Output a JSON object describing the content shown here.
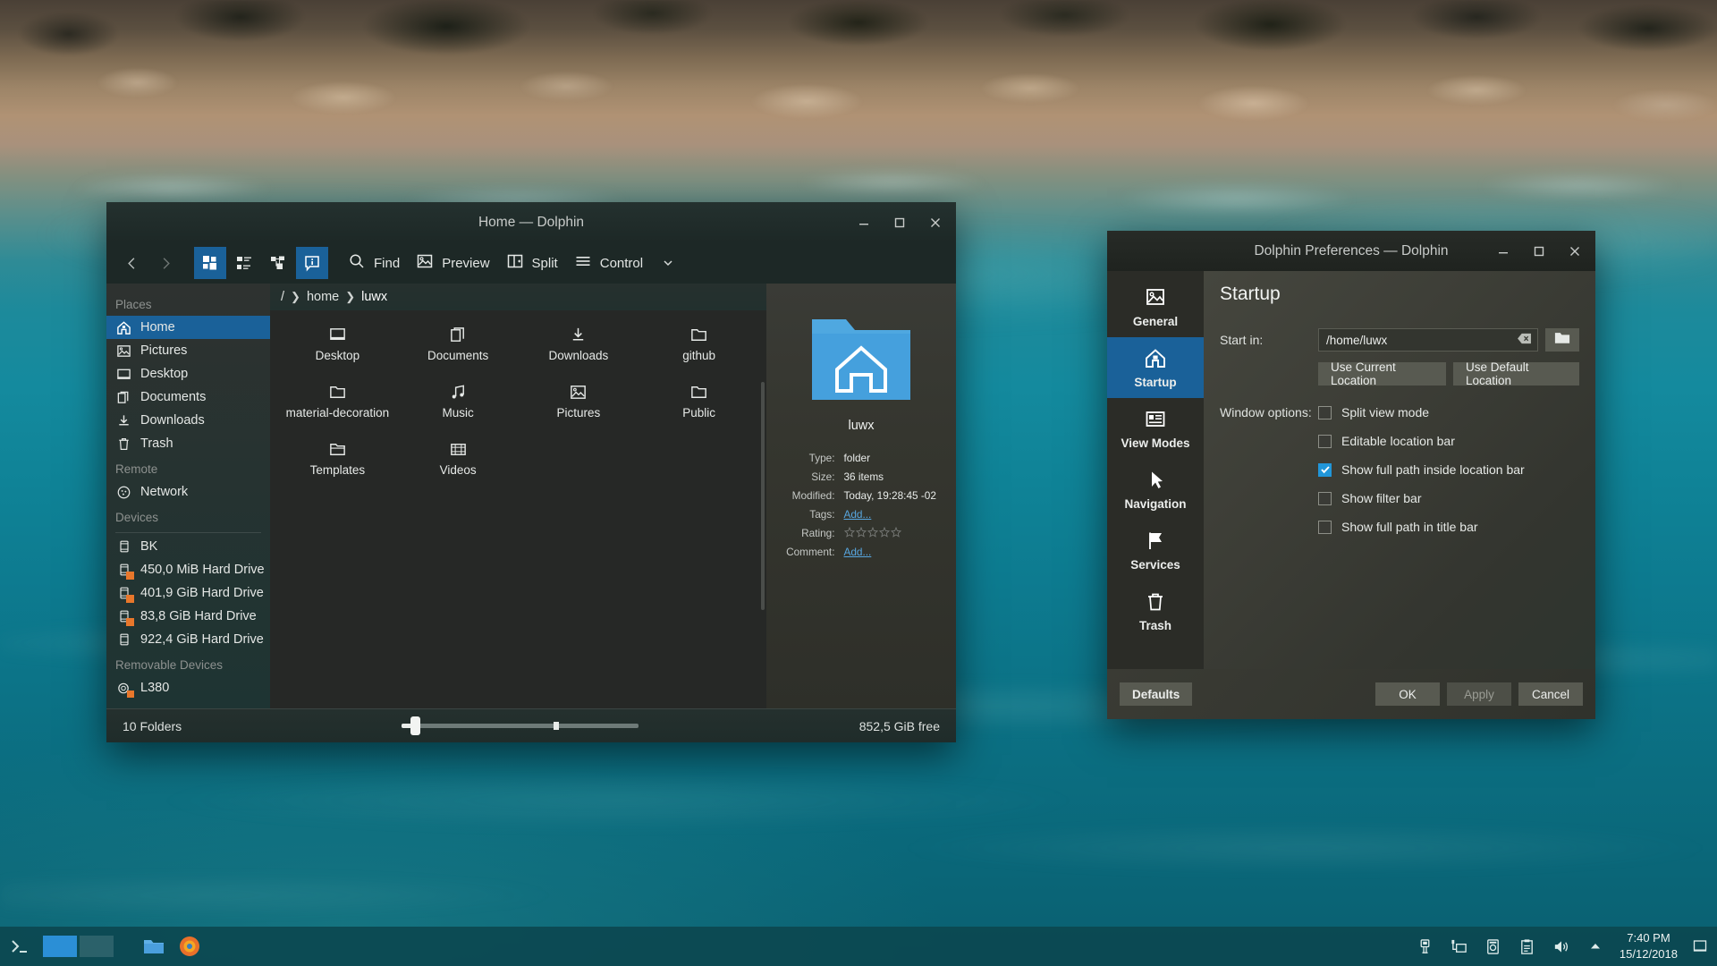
{
  "desktop": {
    "wallpaper_name": "coastal-aerial-wallpaper"
  },
  "dolphin": {
    "title": "Home — Dolphin",
    "window_buttons": {
      "minimize": "minimize-icon",
      "maximize": "maximize-icon",
      "close": "close-icon"
    },
    "toolbar": {
      "back": "back-icon",
      "forward": "forward-icon",
      "view_icons": "view-icons-icon",
      "view_compact": "view-compact-icon",
      "view_details": "view-details-icon",
      "info_panel": "information-panel-icon",
      "find_label": "Find",
      "preview_label": "Preview",
      "split_label": "Split",
      "control_label": "Control"
    },
    "sidebar": {
      "sections": [
        {
          "title": "Places",
          "items": [
            {
              "label": "Home",
              "icon": "home-icon",
              "selected": true
            },
            {
              "label": "Pictures",
              "icon": "pictures-icon",
              "selected": false
            },
            {
              "label": "Desktop",
              "icon": "desktop-icon",
              "selected": false
            },
            {
              "label": "Documents",
              "icon": "documents-icon",
              "selected": false
            },
            {
              "label": "Downloads",
              "icon": "downloads-icon",
              "selected": false
            },
            {
              "label": "Trash",
              "icon": "trash-icon",
              "selected": false
            }
          ]
        },
        {
          "title": "Remote",
          "items": [
            {
              "label": "Network",
              "icon": "network-icon",
              "selected": false
            }
          ]
        },
        {
          "title": "Devices",
          "items": [
            {
              "label": "BK",
              "icon": "drive-icon",
              "selected": false,
              "mounted": false
            },
            {
              "label": "450,0 MiB Hard Drive",
              "icon": "drive-icon",
              "selected": false,
              "mounted": true
            },
            {
              "label": "401,9 GiB Hard Drive",
              "icon": "drive-icon",
              "selected": false,
              "mounted": true
            },
            {
              "label": "83,8 GiB Hard Drive",
              "icon": "drive-icon",
              "selected": false,
              "mounted": true
            },
            {
              "label": "922,4 GiB Hard Drive",
              "icon": "drive-icon",
              "selected": false,
              "mounted": false
            }
          ]
        },
        {
          "title": "Removable Devices",
          "items": [
            {
              "label": "L380",
              "icon": "camera-icon",
              "selected": false,
              "mounted": true
            }
          ]
        }
      ]
    },
    "breadcrumb": {
      "root": "/",
      "parts": [
        "home",
        "luwx"
      ]
    },
    "files": [
      {
        "label": "Desktop",
        "icon": "folder-desktop-icon"
      },
      {
        "label": "Documents",
        "icon": "folder-documents-icon"
      },
      {
        "label": "Downloads",
        "icon": "folder-downloads-icon"
      },
      {
        "label": "github",
        "icon": "folder-icon"
      },
      {
        "label": "material-decoration",
        "icon": "folder-icon"
      },
      {
        "label": "Music",
        "icon": "folder-music-icon"
      },
      {
        "label": "Pictures",
        "icon": "folder-pictures-icon"
      },
      {
        "label": "Public",
        "icon": "folder-icon"
      },
      {
        "label": "Templates",
        "icon": "folder-templates-icon"
      },
      {
        "label": "Videos",
        "icon": "folder-videos-icon"
      }
    ],
    "info_panel": {
      "preview_icon": "folder-home-large-icon",
      "name": "luwx",
      "metadata": [
        {
          "key": "Type:",
          "value": "folder",
          "kind": "text"
        },
        {
          "key": "Size:",
          "value": "36 items",
          "kind": "text"
        },
        {
          "key": "Modified:",
          "value": "Today, 19:28:45 -02",
          "kind": "text"
        },
        {
          "key": "Tags:",
          "value": "Add...",
          "kind": "link"
        },
        {
          "key": "Rating:",
          "value": "",
          "kind": "stars"
        },
        {
          "key": "Comment:",
          "value": "Add...",
          "kind": "link"
        }
      ],
      "rating_stars": 5,
      "rating_filled": 0
    },
    "status": {
      "items_label": "10 Folders",
      "free_label": "852,5 GiB free",
      "zoom_value": 4
    }
  },
  "preferences": {
    "title": "Dolphin Preferences — Dolphin",
    "nav": [
      {
        "label": "General",
        "icon": "general-image-icon",
        "selected": false
      },
      {
        "label": "Startup",
        "icon": "startup-home-icon",
        "selected": true
      },
      {
        "label": "View Modes",
        "icon": "view-modes-icon",
        "selected": false
      },
      {
        "label": "Navigation",
        "icon": "navigation-cursor-icon",
        "selected": false
      },
      {
        "label": "Services",
        "icon": "services-flag-icon",
        "selected": false
      },
      {
        "label": "Trash",
        "icon": "trash-icon",
        "selected": false
      }
    ],
    "page_title": "Startup",
    "start_in": {
      "label": "Start in:",
      "value": "/home/luwx",
      "clear_icon": "clear-text-icon",
      "browse_icon": "folder-browse-icon"
    },
    "location_buttons": [
      "Use Current Location",
      "Use Default Location"
    ],
    "window_options_label": "Window options:",
    "window_options": [
      {
        "label": "Split view mode",
        "checked": false
      },
      {
        "label": "Editable location bar",
        "checked": false
      },
      {
        "label": "Show full path inside location bar",
        "checked": true
      },
      {
        "label": "Show filter bar",
        "checked": false
      },
      {
        "label": "Show full path in title bar",
        "checked": false
      }
    ],
    "footer": {
      "defaults": "Defaults",
      "ok": "OK",
      "apply": "Apply",
      "apply_disabled": true,
      "cancel": "Cancel"
    }
  },
  "taskbar": {
    "launcher_icon": "application-launcher-icon",
    "pager": [
      {
        "active": true
      },
      {
        "active": false
      }
    ],
    "tasks": [
      {
        "icon": "dolphin-file-manager-icon"
      },
      {
        "icon": "firefox-icon"
      }
    ],
    "tray": [
      {
        "icon": "usb-device-icon"
      },
      {
        "icon": "network-wired-icon"
      },
      {
        "icon": "device-notifier-icon"
      },
      {
        "icon": "clipboard-icon"
      },
      {
        "icon": "volume-icon"
      },
      {
        "icon": "show-hidden-icons-arrow-icon"
      }
    ],
    "clock": {
      "time": "7:40 PM",
      "date": "15/12/2018"
    },
    "peek_icon": "show-desktop-icon"
  },
  "colors": {
    "accent": "#1a6199",
    "checkbox_checked": "#2196d9",
    "link": "#58a7e0",
    "taskbar_bg": "#0c4850"
  }
}
